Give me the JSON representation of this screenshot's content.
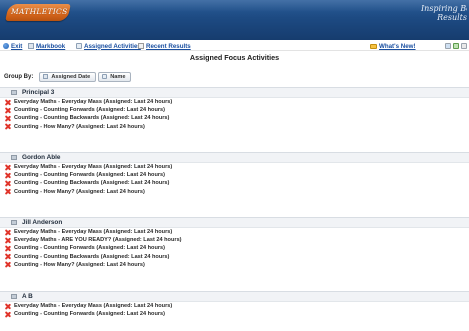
{
  "header": {
    "logo_text": "MATHLETICS",
    "tagline_line1": "Inspiring Bet",
    "tagline_line2": "Results"
  },
  "toolbar": {
    "exit": "Exit",
    "markbook": "Markbook",
    "assigned_activities": "Assigned Activities",
    "recent_results": "Recent Results",
    "whats_new": "What's New!"
  },
  "page": {
    "title": "Assigned Focus Activities"
  },
  "groupby": {
    "label": "Group By:",
    "options": [
      "Assigned Date",
      "Name"
    ]
  },
  "groups": [
    {
      "name": "Principal 3",
      "rows": [
        "Everyday Maths - Everyday Mass (Assigned: Last 24 hours)",
        "Counting - Counting Forwards (Assigned: Last 24 hours)",
        "Counting - Counting Backwards (Assigned: Last 24 hours)",
        "Counting - How Many? (Assigned: Last 24 hours)"
      ]
    },
    {
      "name": "Gordon Able",
      "rows": [
        "Everyday Maths - Everyday Mass (Assigned: Last 24 hours)",
        "Counting - Counting Forwards (Assigned: Last 24 hours)",
        "Counting - Counting Backwards (Assigned: Last 24 hours)",
        "Counting - How Many? (Assigned: Last 24 hours)"
      ]
    },
    {
      "name": "Jill Anderson",
      "rows": [
        "Everyday Maths - Everyday Mass (Assigned: Last 24 hours)",
        "Everyday Maths - ARE YOU READY? (Assigned: Last 24 hours)",
        "Counting - Counting Forwards (Assigned: Last 24 hours)",
        "Counting - Counting Backwards (Assigned: Last 24 hours)",
        "Counting - How Many? (Assigned: Last 24 hours)"
      ]
    },
    {
      "name": "A B",
      "rows": [
        "Everyday Maths - Everyday Mass (Assigned: Last 24 hours)",
        "Counting - Counting Forwards (Assigned: Last 24 hours)"
      ]
    }
  ]
}
